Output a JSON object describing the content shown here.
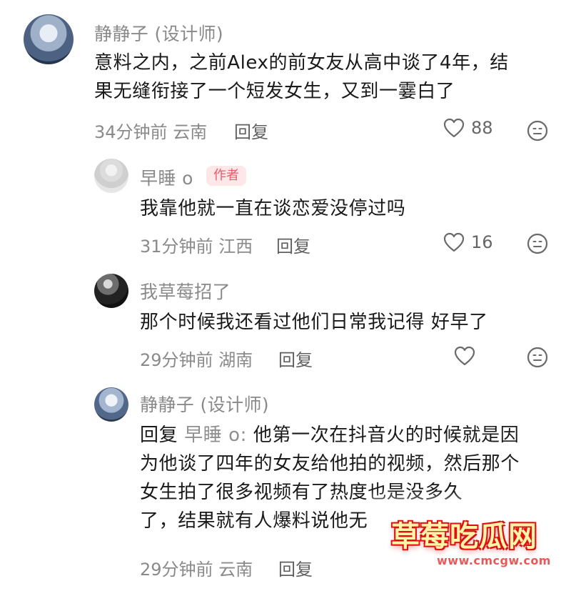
{
  "comments": {
    "main": {
      "username": "静静子 (设计师)",
      "text_line1": "意料之内，之前Alex的前女友从高中谈了4年，结",
      "text_line2": "果无缝衔接了一个短发女生，又到一霎白了",
      "time": "34分钟前",
      "location": "云南",
      "reply_label": "回复",
      "likes": "88"
    },
    "replies": [
      {
        "username": "早睡 o",
        "author_tag": "作者",
        "text": "我靠他就一直在谈恋爱没停过吗",
        "time": "31分钟前",
        "location": "江西",
        "reply_label": "回复",
        "likes": "16"
      },
      {
        "username": "我草莓招了",
        "text": "那个时候我还看过他们日常我记得 好早了",
        "time": "29分钟前",
        "location": "湖南",
        "reply_label": "回复",
        "likes": ""
      },
      {
        "username": "静静子 (设计师)",
        "reply_prefix": "回复",
        "mention": "早睡 o:",
        "text_line1": "他第一次在抖音火的时候就是因",
        "text_line2": "为他谈了四年的女友给他拍的视频，然后那个",
        "text_line3": "女生拍了很多视频有了热度也是没多久",
        "text_line4": "了，结果就有人爆料说他无",
        "time": "29分钟前",
        "location": "云南",
        "reply_label": "回复"
      }
    ]
  },
  "watermark": {
    "title": "草莓吃瓜网",
    "url": "www.cmcgw.com"
  },
  "icons": {
    "like": "heart-outline-icon",
    "emoji": "neutral-face-icon"
  },
  "colors": {
    "text": "#1a1a1a",
    "muted": "#8a8a8a",
    "author_tag_bg": "#fde7e8",
    "author_tag_text": "#f05a6a"
  }
}
